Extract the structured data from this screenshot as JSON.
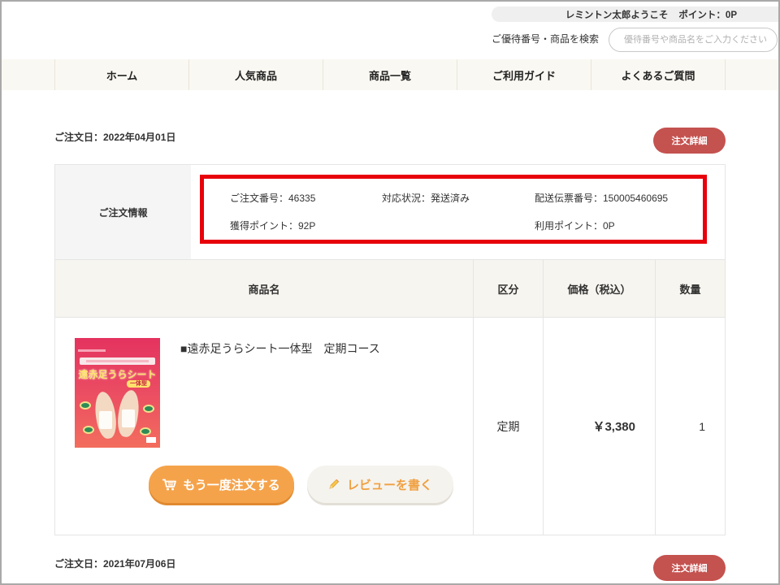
{
  "header": {
    "welcome_name": "レミントン太郎ようこそ",
    "points": "ポイント：0P",
    "search_label": "ご優待番号・商品を検索",
    "search_placeholder": "優待番号や商品名をご入力ください",
    "search_value": ""
  },
  "nav": {
    "items": [
      {
        "label": "ホーム"
      },
      {
        "label": "人気商品"
      },
      {
        "label": "商品一覧"
      },
      {
        "label": "ご利用ガイド"
      },
      {
        "label": "よくあるご質問"
      }
    ]
  },
  "orders": [
    {
      "date": "ご注文日：2022年04月01日",
      "detail_button": "注文詳細",
      "info_label": "ご注文情報",
      "info": {
        "order_number": "ご注文番号：46335",
        "status": "対応状況：発送済み",
        "tracking_number": "配送伝票番号：150005460695",
        "earned_points": "獲得ポイント：92P",
        "used_points": "利用ポイント：0P"
      },
      "table": {
        "headers": {
          "name": "商品名",
          "type": "区分",
          "price": "価格（税込）",
          "qty": "数量"
        },
        "items": [
          {
            "name": "■遠赤足うらシート一体型　定期コース",
            "type": "定期",
            "price": "￥3,380",
            "qty": "1",
            "image": {
              "title": "遠赤足うらシート",
              "subtitle": "一体型"
            },
            "reorder_button": "もう一度注文する",
            "review_button": "レビューを書く"
          }
        ]
      }
    },
    {
      "date": "ご注文日：2021年07月06日",
      "detail_button": "注文詳細"
    }
  ],
  "colors": {
    "detail_button": "#c4524f",
    "reorder_button": "#f5a34b",
    "review_button_text": "#f0a040",
    "nav_background": "#faf8f2",
    "table_header_background": "#f7f5ef",
    "highlight_border": "#e8000b"
  },
  "icons": {
    "reorder": "cart-icon",
    "review": "pencil-icon"
  }
}
